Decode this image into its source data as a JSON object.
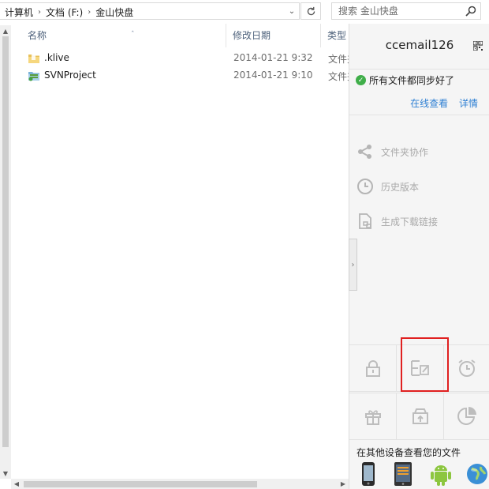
{
  "address": {
    "crumbs": [
      "计算机",
      "文档 (F:)",
      "金山快盘"
    ],
    "search_placeholder": "搜索 金山快盘"
  },
  "columns": {
    "name": "名称",
    "date": "修改日期",
    "type": "类型"
  },
  "files": [
    {
      "name": ".klive",
      "date": "2014-01-21 9:32",
      "type": "文件夹",
      "icon": "folder-icon"
    },
    {
      "name": "SVNProject",
      "date": "2014-01-21 9:10",
      "type": "文件夹",
      "icon": "synced-folder-icon"
    }
  ],
  "panel": {
    "user": "ccemail126",
    "sync_status": "所有文件都同步好了",
    "link_online": "在线查看",
    "link_details": "详情",
    "actions": [
      {
        "label": "文件夹协作",
        "icon": "share-icon"
      },
      {
        "label": "历史版本",
        "icon": "clock-icon"
      },
      {
        "label": "生成下载链接",
        "icon": "download-link-icon"
      }
    ],
    "tools": [
      "lock-icon",
      "edit-document-icon",
      "alarm-clock-icon",
      "gift-icon",
      "upload-box-icon",
      "pie-chart-icon"
    ],
    "devices_title": "在其他设备查看您的文件",
    "devices": [
      "iphone-icon",
      "tablet-icon",
      "android-icon",
      "globe-icon"
    ]
  },
  "colors": {
    "accent_link": "#2d7fd3",
    "sync_ok": "#3fae49",
    "highlight_box": "#e02020"
  }
}
